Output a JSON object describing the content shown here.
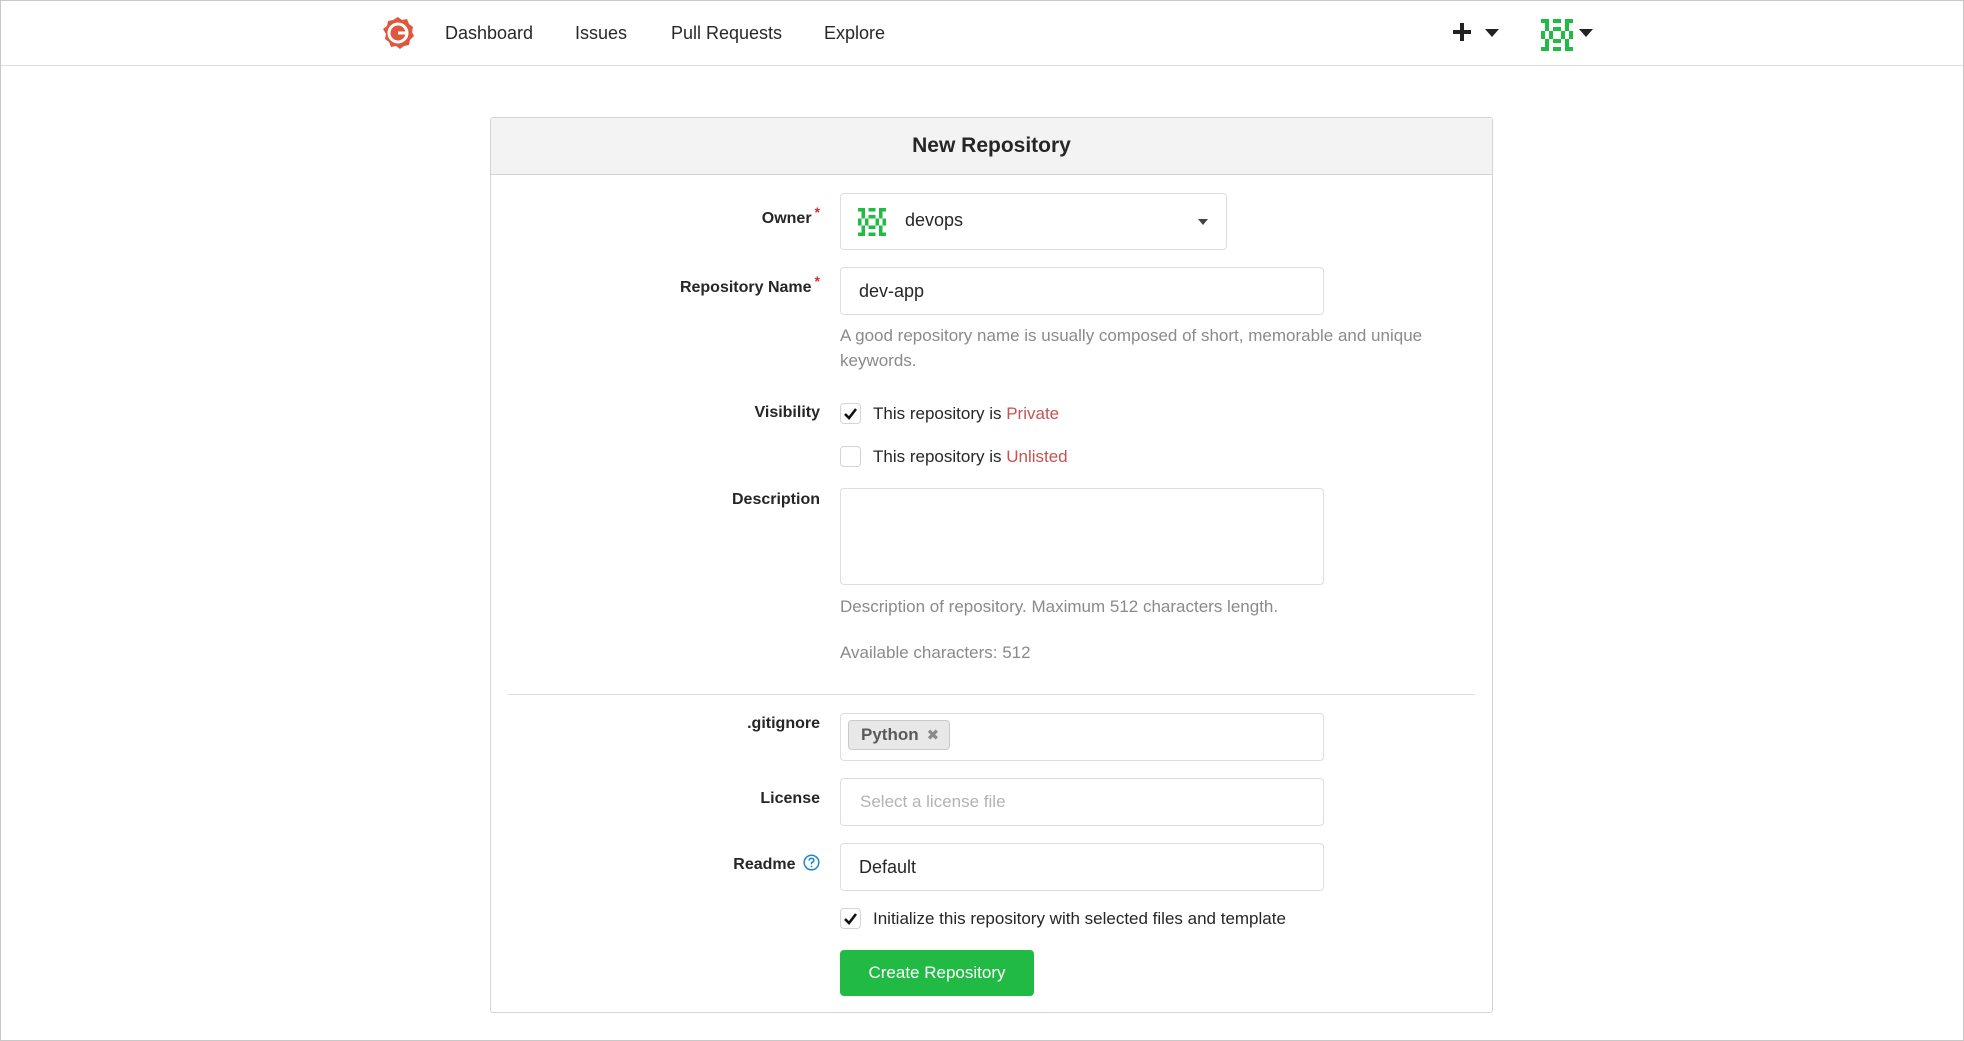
{
  "nav": {
    "items": [
      {
        "label": "Dashboard"
      },
      {
        "label": "Issues"
      },
      {
        "label": "Pull Requests"
      },
      {
        "label": "Explore"
      }
    ],
    "icons": {
      "logo": "gitea-logo-icon",
      "plus": "plus-icon",
      "caret": "caret-down-icon",
      "avatar": "user-avatar-icon"
    }
  },
  "colors": {
    "accent": "#c75252",
    "primary": "#21ba45",
    "required": "#db2828",
    "avatar": "#21ba45",
    "logo": "#e0573f"
  },
  "form": {
    "title": "New Repository",
    "owner": {
      "label": "Owner",
      "value": "devops"
    },
    "repo_name": {
      "label": "Repository Name",
      "value": "dev-app",
      "help": "A good repository name is usually composed of short, memorable and unique keywords."
    },
    "visibility": {
      "label": "Visibility",
      "private": {
        "prefix": "This repository is",
        "word": "Private",
        "checked": true
      },
      "unlisted": {
        "prefix": "This repository is",
        "word": "Unlisted",
        "checked": false
      }
    },
    "description": {
      "label": "Description",
      "value": "",
      "help": "Description of repository. Maximum 512 characters length.",
      "available": "Available characters: 512"
    },
    "gitignore": {
      "label": ".gitignore",
      "tags": [
        {
          "label": "Python"
        }
      ]
    },
    "license": {
      "label": "License",
      "placeholder": "Select a license file"
    },
    "readme": {
      "label": "Readme",
      "value": "Default"
    },
    "init": {
      "label": "Initialize this repository with selected files and template",
      "checked": true
    },
    "submit": {
      "label": "Create Repository"
    }
  }
}
